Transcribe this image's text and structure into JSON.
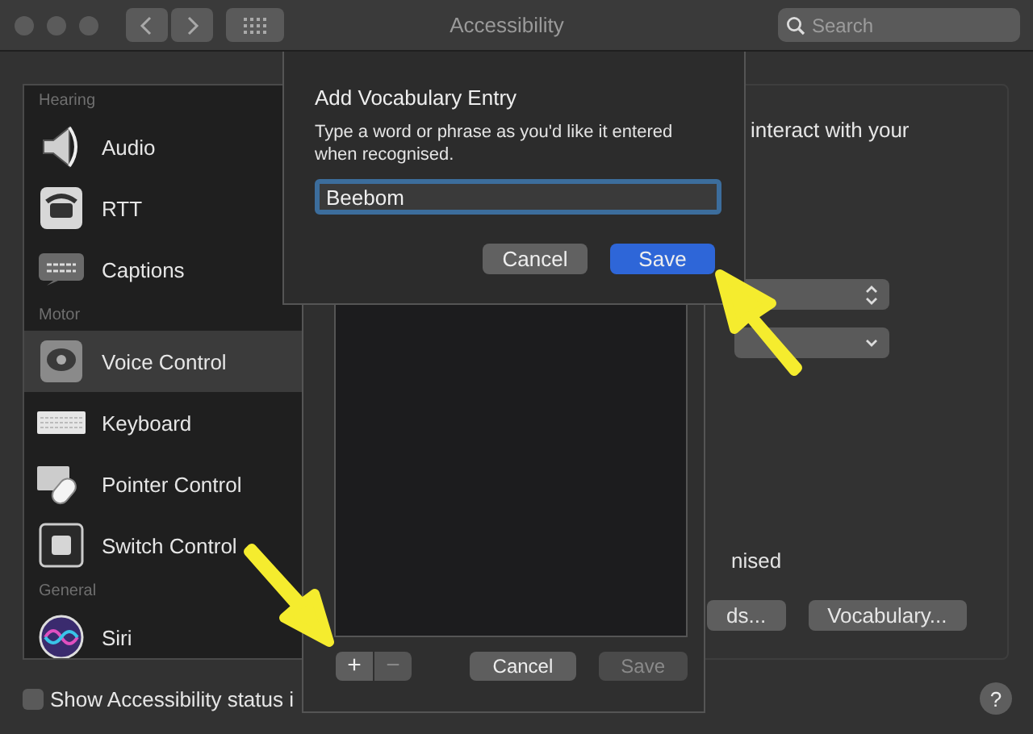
{
  "window": {
    "title": "Accessibility"
  },
  "toolbar": {
    "search": {
      "placeholder": "Search"
    }
  },
  "sidebar": {
    "sections": [
      {
        "header": "Hearing",
        "items": [
          {
            "label": "Audio",
            "kind": "speaker",
            "selected": false
          },
          {
            "label": "RTT",
            "kind": "phone",
            "selected": false
          },
          {
            "label": "Captions",
            "kind": "captions",
            "selected": false
          }
        ]
      },
      {
        "header": "Motor",
        "items": [
          {
            "label": "Voice Control",
            "kind": "voice",
            "selected": true
          },
          {
            "label": "Keyboard",
            "kind": "keyboard",
            "selected": false
          },
          {
            "label": "Pointer Control",
            "kind": "pointer",
            "selected": false
          },
          {
            "label": "Switch Control",
            "kind": "switch",
            "selected": false
          }
        ]
      },
      {
        "header": "General",
        "items": [
          {
            "label": "Siri",
            "kind": "siri",
            "selected": false
          }
        ]
      }
    ]
  },
  "pane": {
    "description": "interact with your",
    "popups": [
      {
        "kind": "stepper"
      },
      {
        "kind": "dropdown"
      }
    ],
    "caption": "nised",
    "buttons": [
      "ds...",
      "Vocabulary..."
    ]
  },
  "status_checkbox": {
    "label": "Show Accessibility status i",
    "checked": false
  },
  "help": "?",
  "vocabulary_sheet": {
    "list_buttons": [
      {
        "label": "+",
        "disabled": false
      },
      {
        "label": "−",
        "disabled": true
      }
    ],
    "actions": [
      {
        "label": "Cancel",
        "disabled": false
      },
      {
        "label": "Save",
        "disabled": true
      }
    ]
  },
  "dialog": {
    "title": "Add Vocabulary Entry",
    "message": "Type a word or phrase as you'd like it entered when recognised.",
    "value": "Beebom",
    "buttons": [
      {
        "label": "Cancel",
        "default": false
      },
      {
        "label": "Save",
        "default": true
      }
    ]
  }
}
